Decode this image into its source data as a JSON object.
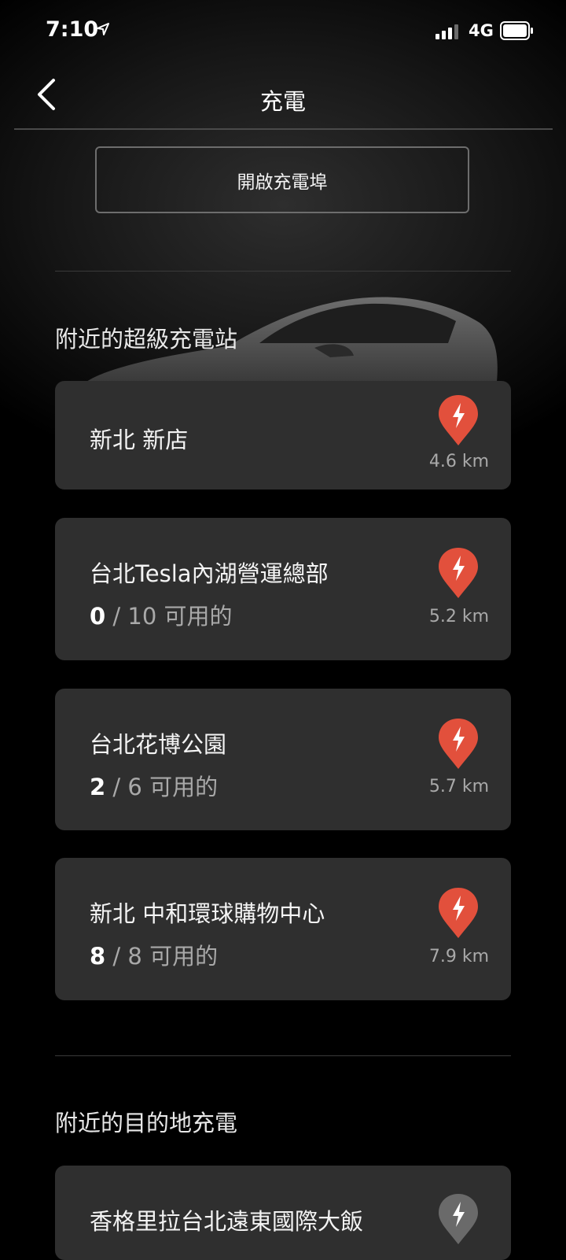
{
  "status_bar": {
    "time": "7:10",
    "network": "4G"
  },
  "header": {
    "title": "充電"
  },
  "open_port_button": {
    "label": "開啟充電埠"
  },
  "superchargers": {
    "title": "附近的超級充電站",
    "stations": [
      {
        "name": "新北 新店",
        "distance": "4.6 km",
        "available": null,
        "total_label": null
      },
      {
        "name": "台北Tesla內湖營運總部",
        "distance": "5.2 km",
        "available": "0",
        "total_label": " / 10 可用的"
      },
      {
        "name": "台北花博公園",
        "distance": "5.7 km",
        "available": "2",
        "total_label": " / 6 可用的"
      },
      {
        "name": "新北 中和環球購物中心",
        "distance": "7.9 km",
        "available": "8",
        "total_label": " / 8 可用的"
      }
    ]
  },
  "destination": {
    "title": "附近的目的地充電",
    "stations": [
      {
        "name": "香格里拉台北遠東國際大飯"
      }
    ]
  },
  "colors": {
    "pin": "#e2503c",
    "pin_gray": "#6a6a6a",
    "card": "#2f2f2f",
    "background": "#000000"
  },
  "icons": [
    "location-arrow-icon",
    "signal-icon",
    "battery-icon",
    "back-chevron-icon",
    "supercharger-pin-icon",
    "destination-pin-icon"
  ]
}
